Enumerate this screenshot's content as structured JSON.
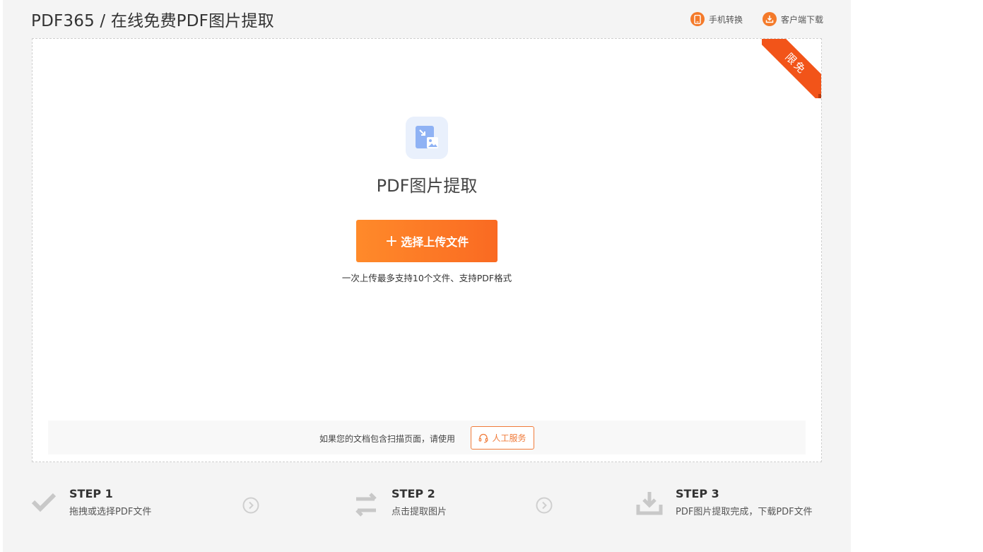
{
  "header": {
    "title": "PDF365 / 在线免费PDF图片提取",
    "links": [
      {
        "label": "手机转换",
        "icon": "mobile-icon"
      },
      {
        "label": "客户端下载",
        "icon": "download-icon"
      }
    ]
  },
  "upload": {
    "ribbon": "限免",
    "tool_title": "PDF图片提取",
    "button_label": "选择上传文件",
    "hint": "一次上传最多支持10个文件、支持PDF格式"
  },
  "service": {
    "text": "如果您的文档包含扫描页面，请使用",
    "button_label": "人工服务"
  },
  "steps": [
    {
      "label": "STEP 1",
      "desc": "拖拽或选择PDF文件",
      "icon": "check-icon"
    },
    {
      "label": "STEP 2",
      "desc": "点击提取图片",
      "icon": "swap-icon"
    },
    {
      "label": "STEP 3",
      "desc": "PDF图片提取完成，下载PDF文件",
      "icon": "download-tray-icon"
    }
  ],
  "colors": {
    "accent": "#f47a2a",
    "ribbon": "#f25419",
    "panel_bg": "#f4f4f4",
    "tool_icon_bg": "#e9f0fc"
  }
}
